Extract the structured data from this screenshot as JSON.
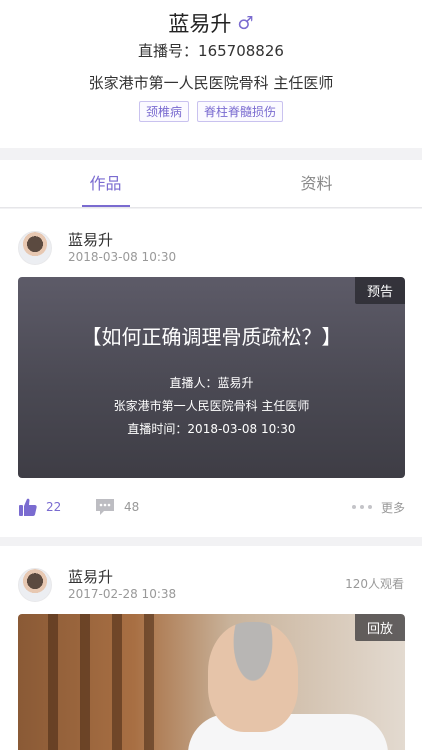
{
  "profile": {
    "name": "蓝易升",
    "gender_symbol": "♂",
    "live_id": "直播号：165708826",
    "hospital": "张家港市第一人民医院骨科 主任医师",
    "tags": [
      "颈椎病",
      "脊柱脊髓损伤"
    ]
  },
  "tabs": [
    {
      "label": "作品",
      "active": true
    },
    {
      "label": "资料",
      "active": false
    }
  ],
  "posts": [
    {
      "author": "蓝易升",
      "date": "2018-03-08 10:30",
      "badge": "预告",
      "title": "【如何正确调理骨质疏松？】",
      "lines": [
        "直播人：蓝易升",
        "张家港市第一人民医院骨科 主任医师",
        "直播时间：2018-03-08 10:30"
      ],
      "likes": "22",
      "comments": "48",
      "more": "更多"
    },
    {
      "author": "蓝易升",
      "date": "2017-02-28 10:38",
      "views": "120人观看",
      "badge": "回放"
    }
  ],
  "colors": {
    "accent": "#7a6bd0",
    "muted": "#999999"
  }
}
